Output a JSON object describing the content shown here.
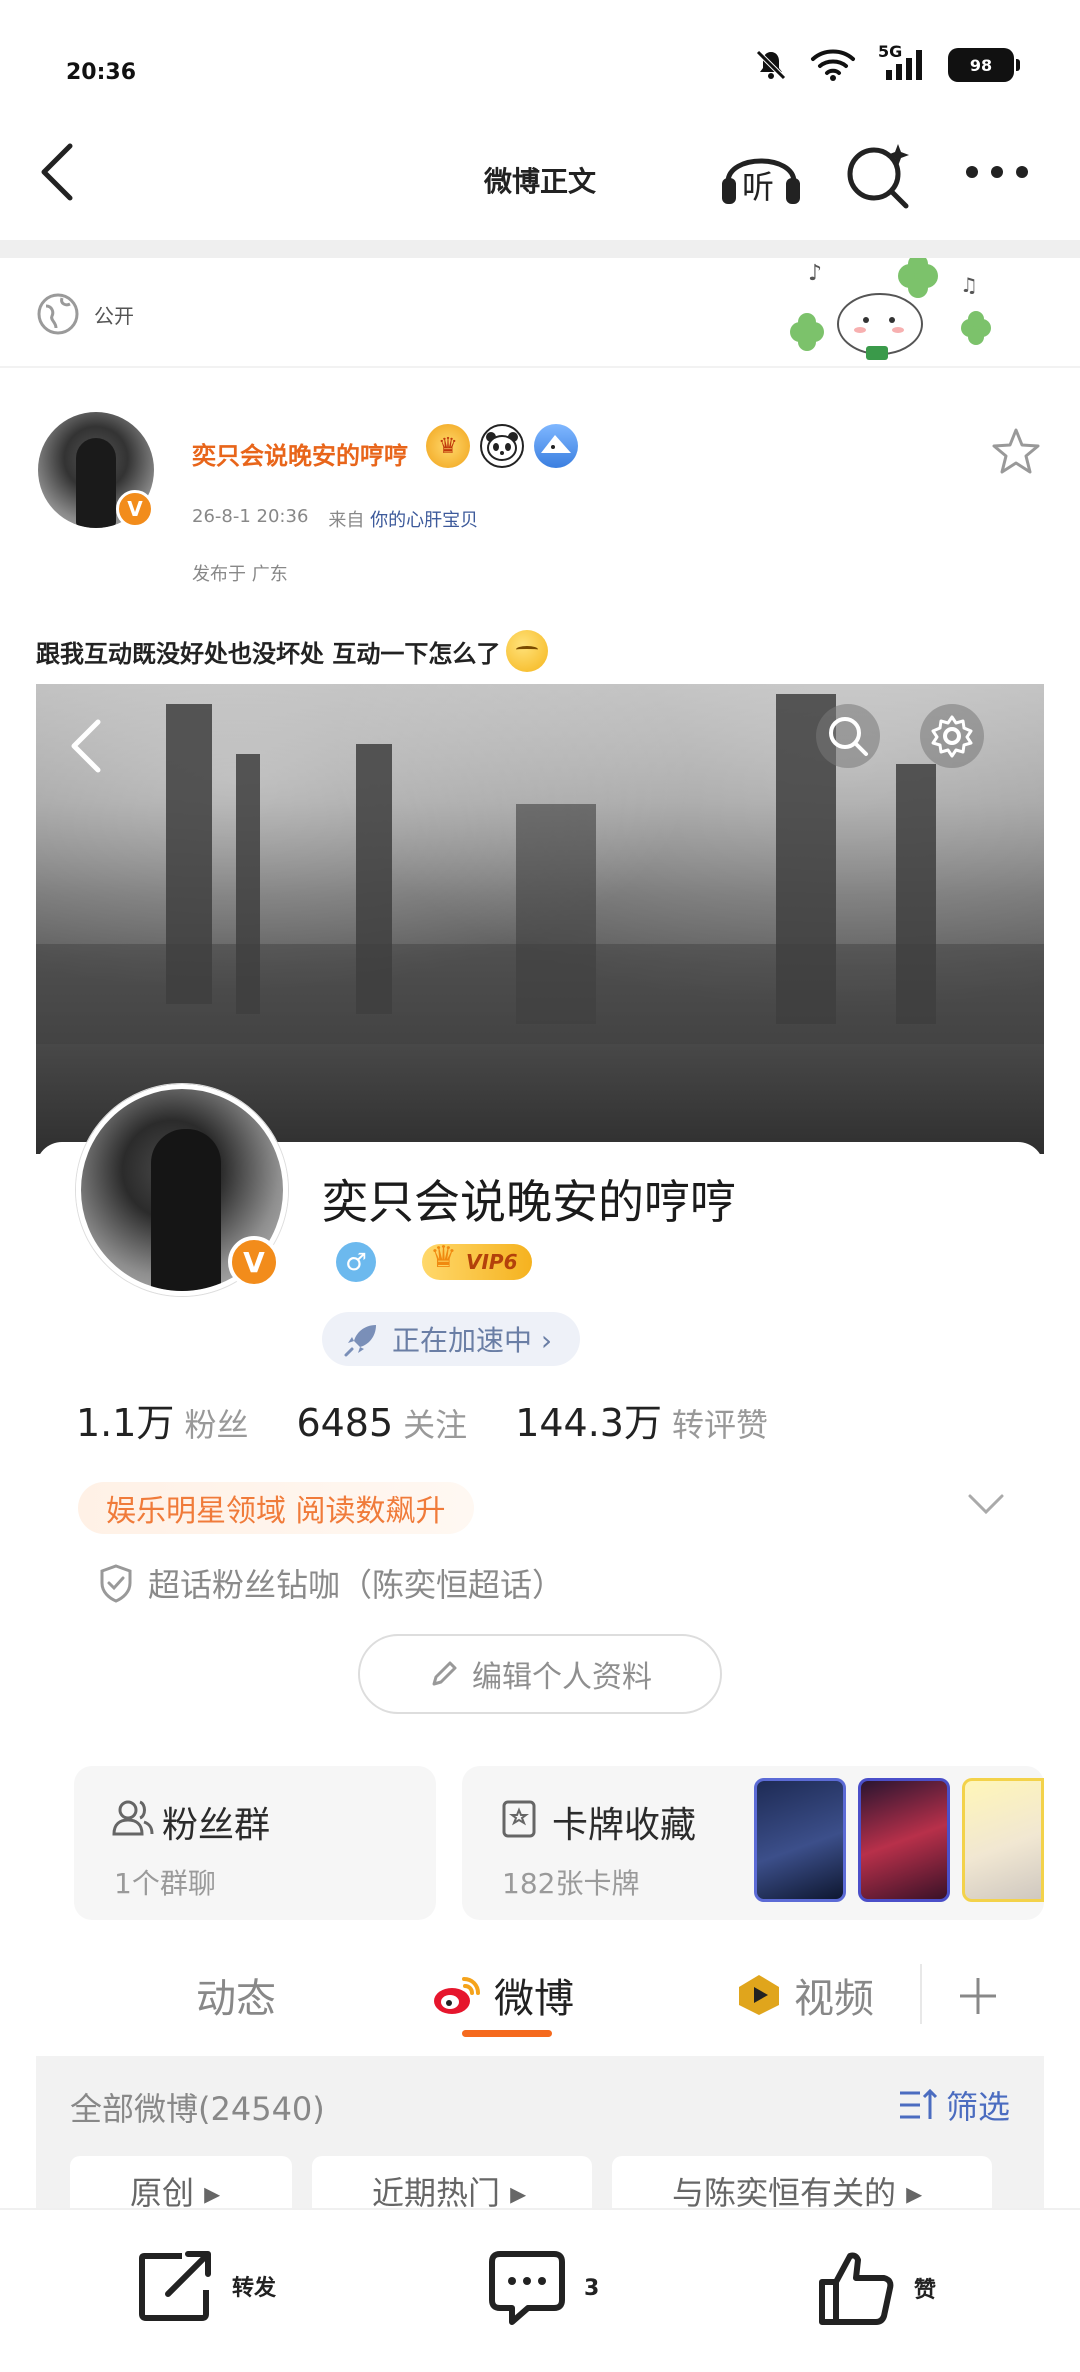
{
  "status_bar": {
    "time": "20:36",
    "network": "5G",
    "battery": "98"
  },
  "nav": {
    "title": "微博正文",
    "listen_label": "听"
  },
  "visibility": {
    "label": "公开"
  },
  "post": {
    "author_name": "奕只会说晚安的哼哼",
    "time": "26-8-1 20:36",
    "source_prefix": "来自",
    "source": "你的心肝宝贝",
    "location": "发布于 广东",
    "text": "跟我互动既没好处也没坏处 互动一下怎么了"
  },
  "profile": {
    "name": "奕只会说晚安的哼哼",
    "gender": "♂",
    "vip": "VIP6",
    "boost": "正在加速中 ›",
    "stats": [
      {
        "num": "1.1万",
        "label": "粉丝"
      },
      {
        "num": "6485",
        "label": "关注"
      },
      {
        "num": "144.3万",
        "label": "转评赞"
      }
    ],
    "field_tag": "娱乐明星领域 阅读数飙升",
    "supertopic": "超话粉丝钻咖（陈奕恒超话）",
    "edit_button": "编辑个人资料",
    "fan_group": {
      "title": "粉丝群",
      "sub": "1个群聊"
    },
    "cards": {
      "title": "卡牌收藏",
      "sub": "182张卡牌"
    },
    "tabs": [
      "动态",
      "微博",
      "视频"
    ],
    "all_weibo": "全部微博(24540)",
    "filter": "筛选",
    "chips": [
      "原创 ▸",
      "近期热门 ▸",
      "与陈奕恒有关的 ▸"
    ]
  },
  "actions": {
    "repost": "转发",
    "comment": "3",
    "like": "赞"
  },
  "colors": {
    "accent": "#f56a1e",
    "author": "#e8651a",
    "link": "#3d5a9b",
    "vip_badge": "#f28c1b"
  }
}
